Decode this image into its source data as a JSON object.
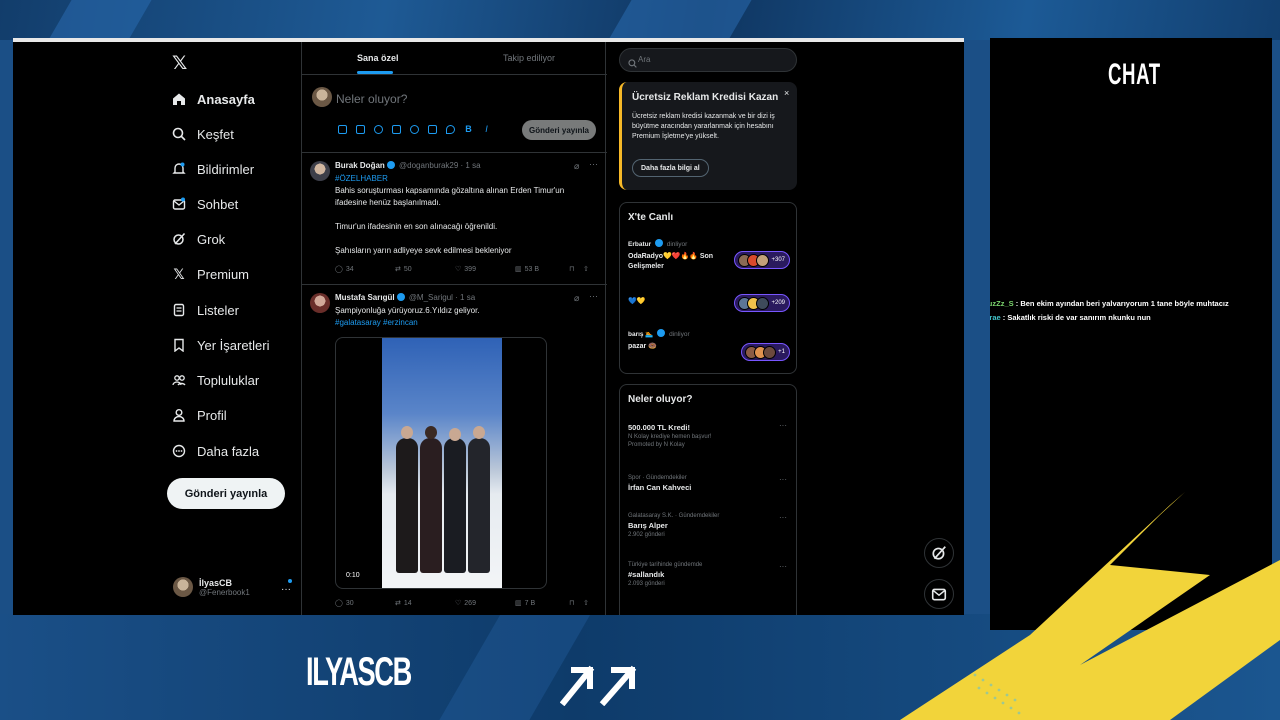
{
  "sidebar": {
    "items": [
      {
        "label": "Anasayfa"
      },
      {
        "label": "Keşfet"
      },
      {
        "label": "Bildirimler"
      },
      {
        "label": "Sohbet"
      },
      {
        "label": "Grok"
      },
      {
        "label": "Premium"
      },
      {
        "label": "Listeler"
      },
      {
        "label": "Yer İşaretleri"
      },
      {
        "label": "Topluluklar"
      },
      {
        "label": "Profil"
      },
      {
        "label": "Daha fazla"
      }
    ],
    "post_button": "Gönderi yayınla",
    "account": {
      "name": "İlyasCB",
      "handle": "@Fenerbook1"
    }
  },
  "feed": {
    "tabs": [
      {
        "label": "Sana özel"
      },
      {
        "label": "Takip ediliyor"
      }
    ],
    "composer": {
      "placeholder": "Neler oluyor?",
      "button": "Gönderi yayınla"
    },
    "tweets": [
      {
        "name": "Burak Doğan",
        "handle": "@doganburak29 · 1 sa",
        "hashtag": "#ÖZELHABER",
        "lines": [
          "Bahis soruşturması kapsamında gözaltına alınan Erden Timur'un ifadesine henüz başlanılmadı.",
          "Timur'un ifadesinin en son alınacağı öğrenildi.",
          "Şahısların yarın adliyeye sevk edilmesi bekleniyor"
        ],
        "replies": "34",
        "reposts": "50",
        "likes": "399",
        "views": "53 B"
      },
      {
        "name": "Mustafa Sarıgül",
        "handle": "@M_Sarigul · 1 sa",
        "text": "Şampiyonluğa yürüyoruz.6.Yıldız geliyor.",
        "tags": "#galatasaray #erzincan",
        "video_duration": "0:10",
        "replies": "30",
        "reposts": "14",
        "likes": "269",
        "views": "7 B"
      }
    ]
  },
  "right": {
    "search_placeholder": "Ara",
    "promo": {
      "title": "Ücretsiz Reklam Kredisi Kazan",
      "close": "×",
      "text": "Ücretsiz reklam kredisi kazanmak ve bir dizi iş büyütme aracından yararlanmak için hesabını Premium İşletme'ye yükselt.",
      "button": "Daha fazla bilgi al"
    },
    "live": {
      "title": "X'te Canlı",
      "spaces": [
        {
          "host": "Erbatur",
          "status": "dinliyor",
          "title": "OdaRadyo💛❤️🔥🔥 Son Gelişmeler",
          "count": "+307"
        },
        {
          "host": "",
          "status": "",
          "title": "💙💛",
          "count": "+209"
        },
        {
          "host": "barış 🏊",
          "status": "dinliyor",
          "title": "pazar 🍩",
          "count": "+1"
        }
      ]
    },
    "trends": {
      "title": "Neler oluyor?",
      "items": [
        {
          "category": "",
          "name": "500.000 TL Kredi!",
          "sub": "N Kolay krediye hemen başvur!",
          "promoted": "Promoted by N Kolay"
        },
        {
          "category": "Spor · Gündemdekiler",
          "name": "İrfan Can Kahveci",
          "sub": ""
        },
        {
          "category": "Galatasaray S.K. · Gündemdekiler",
          "name": "Barış Alper",
          "sub": "2.902 gönderi"
        },
        {
          "category": "Türkiye tarihinde gündemde",
          "name": "#sallandık",
          "sub": "2.093 gönderi"
        }
      ]
    }
  },
  "chat": {
    "title": "CHAT",
    "messages": [
      {
        "user": "BuzZz_S",
        "text": ": Ben ekim ayından beri yalvarıyorum 1 tane böyle muhtacız"
      },
      {
        "user": "omcrae",
        "text": ": Sakatlık riski de var sanırım nkunku nun"
      }
    ]
  },
  "overlay": {
    "brand": "ILYASCB"
  },
  "colors": {
    "accent": "#1d9bf0",
    "promo_border": "#f7b928",
    "chat_deco": "#f2d43a",
    "overlay_blue": "#1b4f86"
  }
}
